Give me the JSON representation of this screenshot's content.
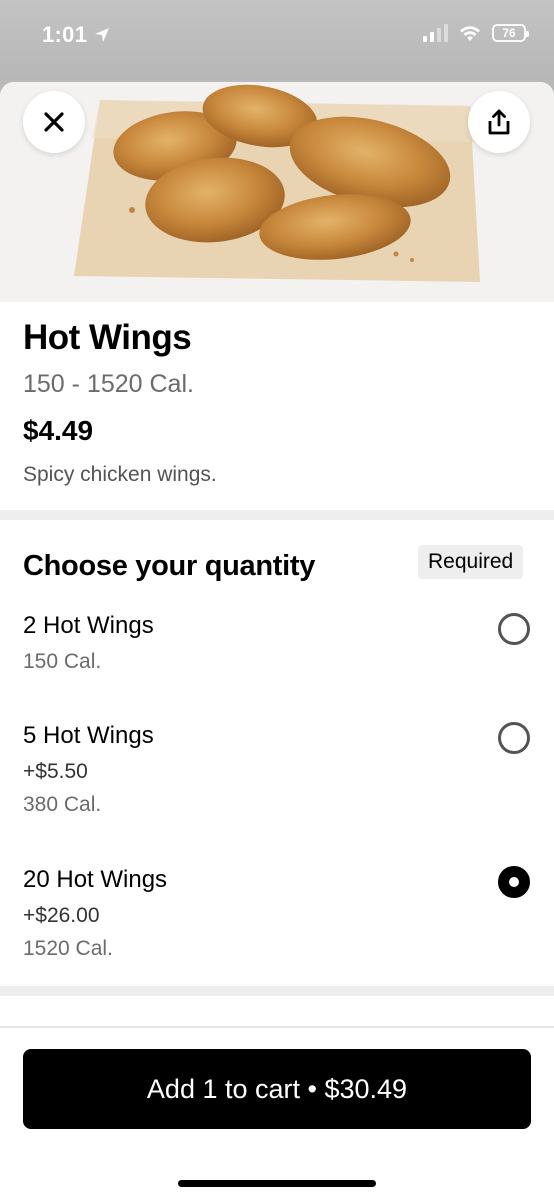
{
  "status_bar": {
    "time": "1:01",
    "battery": "76",
    "location_icon": "location-arrow-icon",
    "wifi_icon": "wifi-icon",
    "signal_icon": "cellular-signal-icon"
  },
  "header": {
    "close_icon": "close-icon",
    "share_icon": "share-icon",
    "image_icon": "hot-wings-photo"
  },
  "item": {
    "title": "Hot Wings",
    "calories": "150 - 1520 Cal.",
    "price": "$4.49",
    "description": "Spicy chicken wings."
  },
  "quantity_section": {
    "title": "Choose your quantity",
    "badge": "Required",
    "options": [
      {
        "name": "2 Hot Wings",
        "price": "",
        "calories": "150 Cal.",
        "selected": false
      },
      {
        "name": "5 Hot Wings",
        "price": "+$5.50",
        "calories": "380 Cal.",
        "selected": false
      },
      {
        "name": "20 Hot Wings",
        "price": "+$26.00",
        "calories": "1520 Cal.",
        "selected": true
      }
    ]
  },
  "footer": {
    "add_to_cart_label": "Add 1 to cart • $30.49"
  },
  "colors": {
    "primary": "#000000",
    "secondary_text": "#6b6b6b",
    "badge_bg": "#eeeeee"
  }
}
